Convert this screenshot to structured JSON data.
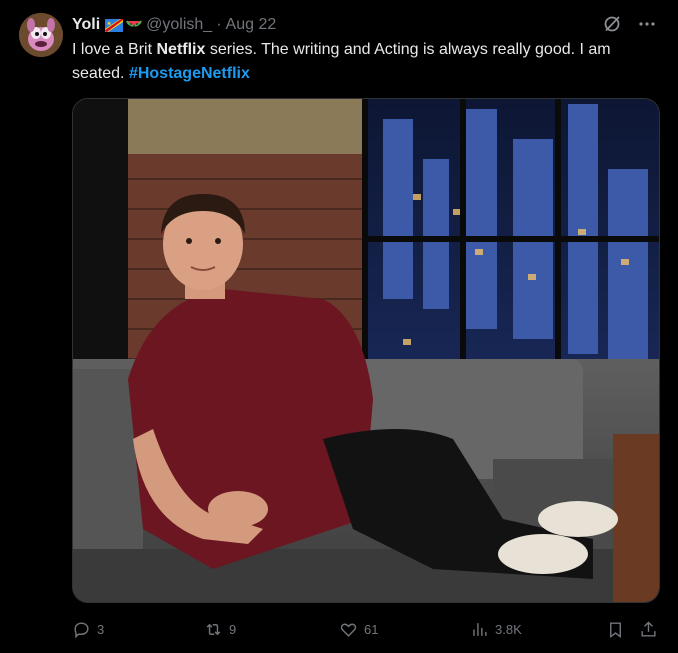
{
  "tweet": {
    "display_name": "Yoli",
    "handle": "@yolish_",
    "separator": "·",
    "timestamp": "Aug 22",
    "text_part1": "I love a Brit ",
    "text_bold": "Netflix",
    "text_part2": " series. The writing and Acting is always really good. I am seated. ",
    "hashtag": "#HostageNetflix"
  },
  "header_icons": [
    "grok-icon",
    "more-icon"
  ],
  "media": {
    "type": "video-frame",
    "alt_description": ""
  },
  "actions": {
    "reply_count": "3",
    "retweet_count": "9",
    "like_count": "61",
    "views_count": "3.8K"
  },
  "colors": {
    "link": "#1d9bf0",
    "muted": "#71767b",
    "background": "#000000"
  }
}
